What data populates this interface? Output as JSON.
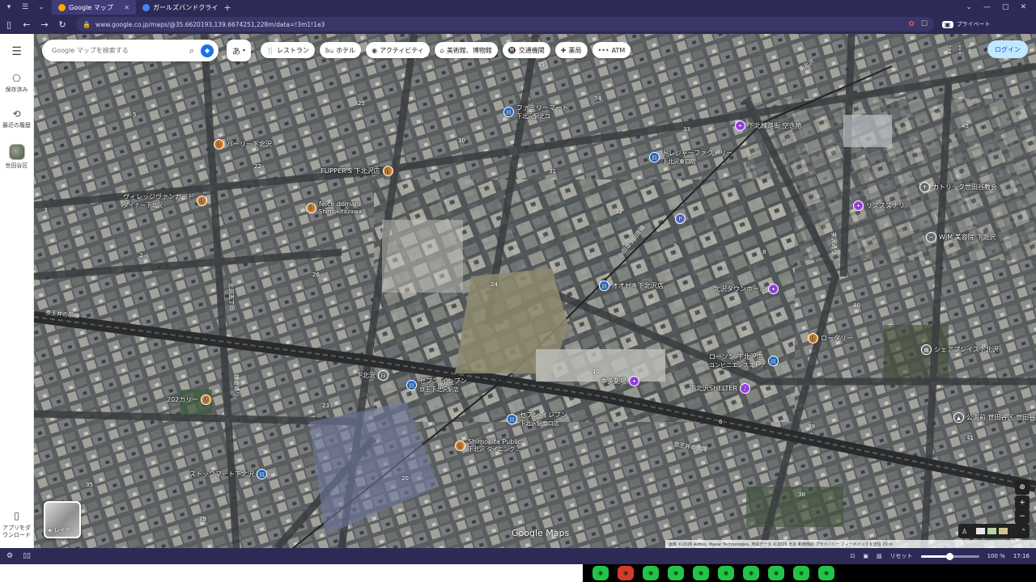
{
  "browser": {
    "tabs": [
      {
        "title": "Google マップ",
        "active": true,
        "favicon_color": "#f9ab00"
      },
      {
        "title": "ガールズバンドクライ - Google",
        "active": false,
        "favicon_color": "#4285f4"
      }
    ],
    "new_tab": "+",
    "url": "www.google.co.jp/maps/@35.6620193,139.6674251,228m/data=!3m1!1e3",
    "private_label": "プライベート"
  },
  "rail": {
    "saved": "保存済み",
    "recent": "最近の履歴",
    "area": "世田谷区",
    "app_download": "アプリをダウンロード"
  },
  "search": {
    "placeholder": "Google マップを検索する",
    "ime_label": "あ"
  },
  "chips": [
    {
      "icon": "restaurant-icon",
      "glyph": "🍴",
      "label": "レストラン"
    },
    {
      "icon": "hotel-icon",
      "glyph": "🛏",
      "label": "ホテル"
    },
    {
      "icon": "camera-icon",
      "glyph": "◉",
      "label": "アクティビティ"
    },
    {
      "icon": "museum-icon",
      "glyph": "⌂",
      "label": "美術館、博物館"
    },
    {
      "icon": "transit-icon",
      "glyph": "🚇",
      "label": "交通機関"
    },
    {
      "icon": "pharmacy-icon",
      "glyph": "✚",
      "label": "薬局"
    },
    {
      "icon": "more-icon",
      "glyph": "•••",
      "label": "ATM"
    }
  ],
  "login_label": "ログイン",
  "pois": [
    {
      "name": "ファミリーマート",
      "sub": "下北沢駅北口",
      "color": "blue"
    },
    {
      "name": "下北線路街 空き地",
      "sub": "",
      "color": "purple"
    },
    {
      "name": "トレジャーファクトリー",
      "sub": "下北沢東口店",
      "color": "blue"
    },
    {
      "name": "パーリー下北沢",
      "sub": "",
      "color": "orange"
    },
    {
      "name": "FLIPPER'S 下北沢店",
      "sub": "",
      "color": "orange"
    },
    {
      "name": "ヴィレッジヴァンガード",
      "sub": "ダイナー下北沢",
      "color": "orange"
    },
    {
      "name": "feice domani",
      "sub": "Shimokitazawa...",
      "color": "orange"
    },
    {
      "name": "カトリック世田谷教会",
      "sub": "",
      "color": "gray"
    },
    {
      "name": "リズスズナリ",
      "sub": "",
      "color": "purple"
    },
    {
      "name": "WJM 美容院 下北沢",
      "sub": "",
      "color": "gray"
    },
    {
      "name": "オオゼキ下北沢店",
      "sub": "",
      "color": "blue"
    },
    {
      "name": "北沢タウンホール",
      "sub": "",
      "color": "purple"
    },
    {
      "name": "ロータリー",
      "sub": "",
      "color": "orange"
    },
    {
      "name": "ローソン 下北沢店",
      "sub": "コンビニエンスストア",
      "color": "blue"
    },
    {
      "name": "本多劇場",
      "sub": "",
      "color": "purple"
    },
    {
      "name": "下北沢SHELTER",
      "sub": "",
      "color": "purple"
    },
    {
      "name": "セブン-イレブン",
      "sub": "京王下北沢駅店",
      "color": "blue"
    },
    {
      "name": "セブン-イレブン",
      "sub": "下北沢駅南口店",
      "color": "blue"
    },
    {
      "name": "202カリー",
      "sub": "",
      "color": "orange"
    },
    {
      "name": "Shimokita Public",
      "sub": "下北沢 ダイニング...",
      "color": "orange"
    },
    {
      "name": "ストックマート下北沢",
      "sub": "",
      "color": "blue"
    },
    {
      "name": "シェアプレイス下北沢",
      "sub": "",
      "color": "gray"
    },
    {
      "name": "公園前 世田谷区 世田谷区",
      "sub": "",
      "color": "gray"
    },
    {
      "name": "下北沢",
      "sub": "",
      "color": "gray"
    }
  ],
  "streets": {
    "odakyu": "小田急小田原線",
    "keio_west": "京王井の頭線",
    "keio_east": "京王井の頭線",
    "chazawa": "茶沢通り",
    "kamaborough": "鎌倉通り",
    "kitazawa_north": "北沢五丁目",
    "higashi": "東北沢"
  },
  "block_numbers": [
    "35",
    "34",
    "33",
    "25",
    "30",
    "31",
    "32",
    "22",
    "26",
    "24",
    "23",
    "20",
    "10",
    "9",
    "8",
    "6",
    "39",
    "40",
    "38",
    "41",
    "45",
    "5",
    "3",
    "2",
    "29",
    "1"
  ],
  "map_logo": "Google Maps",
  "layers_label": "レイヤ",
  "attribution": "画像 ©2026 Airbus, Maxar Technologies, 地図データ ©2026   日本   利用規約   プライバシー   フィードバックを送信   20 m",
  "statusbar": {
    "reset": "リセット",
    "zoom_value": "100 %",
    "zoom_level": 0.5,
    "time": "17:16"
  },
  "taskbar_apps": 10
}
